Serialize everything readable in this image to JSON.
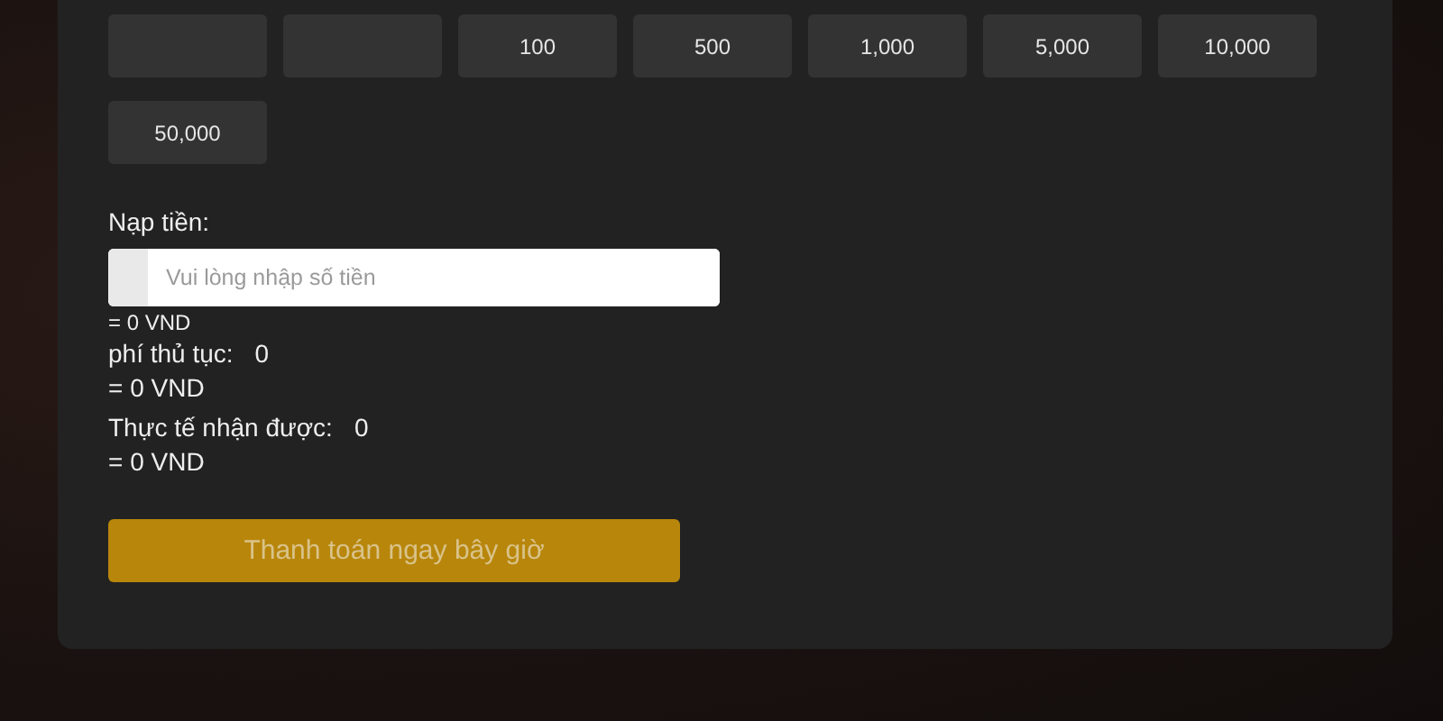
{
  "amount_buttons": [
    "100",
    "500",
    "1,000",
    "5,000",
    "10,000",
    "50,000"
  ],
  "deposit": {
    "label": "Nạp tiền:",
    "placeholder": "Vui lòng nhập số tiền",
    "converted": "= 0 VND"
  },
  "fee": {
    "label": "phí thủ tục:",
    "value": "0",
    "converted": "= 0 VND"
  },
  "received": {
    "label": "Thực tế nhận được:",
    "value": "0",
    "converted": "= 0 VND"
  },
  "submit": {
    "label": "Thanh toán ngay bây giờ",
    "disabled": true
  }
}
